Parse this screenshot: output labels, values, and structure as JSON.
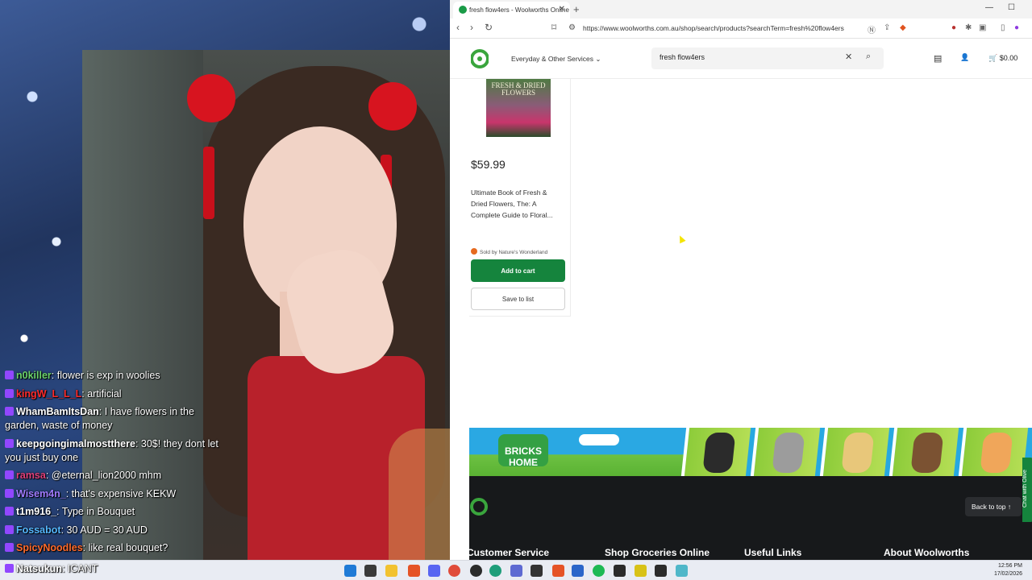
{
  "chat": {
    "messages": [
      {
        "user": "n0killer",
        "text": "flower is exp in woolies",
        "color": "#6bd36a"
      },
      {
        "user": "kingW_L_L_L",
        "text": "artificial",
        "color": "#ff2a2a"
      },
      {
        "user": "WhamBamItsDan",
        "text": "I have flowers in the garden, waste of money",
        "color": "#ffffff"
      },
      {
        "user": "keepgoingimalmostthere",
        "text": "30$! they dont let you just buy one",
        "color": "#ffffff"
      },
      {
        "user": "ramsa",
        "text": "@eternal_lion2000 mhm",
        "color": "#e0407a"
      },
      {
        "user": "Wisem4n_",
        "text": "that's expensive KEKW",
        "color": "#a07bff"
      },
      {
        "user": "t1m916_",
        "text": "Type in Bouquet",
        "color": "#ffffff"
      },
      {
        "user": "Fossabot",
        "text": "30 AUD = 30 AUD",
        "color": "#55b8ff"
      },
      {
        "user": "SpicyNoodles",
        "text": "like real bouquet?",
        "color": "#ff6a2a"
      }
    ],
    "last_message": {
      "user": "Natsukun",
      "text": "ICANT"
    }
  },
  "browser": {
    "tab_title": "fresh flow4ers - Woolworths Online",
    "url": "https://www.woolworths.com.au/shop/search/products?searchTerm=fresh%20flow4ers",
    "new_tab": "+",
    "close_tab": "✕",
    "window_controls": {
      "minimize": "—",
      "maximize": "☐",
      "close": "✕"
    }
  },
  "site": {
    "menu_label": "Everyday & Other Services",
    "menu_chevron": "⌄",
    "search_value": "fresh flow4ers",
    "search_clear": "✕",
    "search_icon": "⌕",
    "list_icon": "▤",
    "account_icon": "👤",
    "cart_total": "$0.00",
    "cart_icon": "🛒"
  },
  "product": {
    "book_title": "FRESH & DRIED FLOWERS",
    "price": "$59.99",
    "name": "Ultimate Book of Fresh & Dried Flowers, The: A Complete Guide to Floral...",
    "seller": "Sold by Nature's Wonderland",
    "add_label": "Add to cart",
    "save_label": "Save to list"
  },
  "banner": {
    "logo_text": "BRICKS HOME"
  },
  "footer": {
    "back_to_top": "Back to top ↑",
    "headings": [
      "Customer Service",
      "Shop Groceries Online",
      "Useful Links",
      "About Woolworths"
    ],
    "chat_with_olive": "Chat with Olive"
  },
  "taskbar": {
    "time": "12:56 PM",
    "date": "17/02/2026",
    "icons": [
      "windows-start",
      "task-view",
      "file-explorer",
      "brave",
      "discord",
      "chrome",
      "obs",
      "edge",
      "notepad",
      "brave-2",
      "word",
      "spotify",
      "terminal",
      "app-yellow",
      "terminal-2",
      "app-teal"
    ]
  },
  "colors": {
    "woolworths_green": "#15843d",
    "footer_dark": "#17191b",
    "twitch_purple": "#9147ff"
  }
}
